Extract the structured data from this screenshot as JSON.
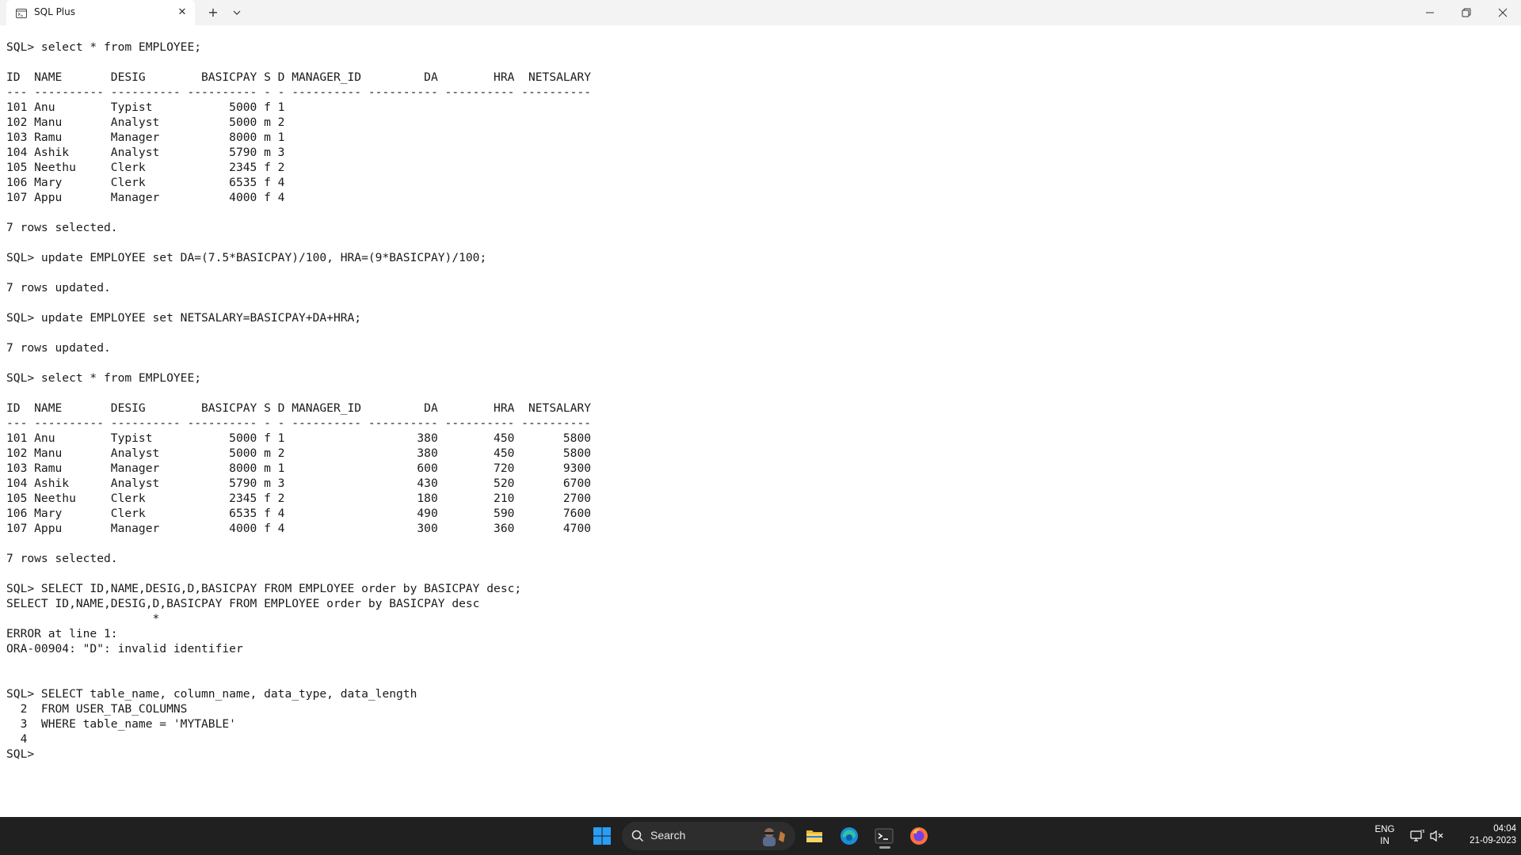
{
  "window": {
    "tab_title": "SQL Plus",
    "tab_close_glyph": "✕",
    "new_tab_glyph": "+",
    "dropdown_glyph": "⌄"
  },
  "console_lines": [
    "SQL> select * from EMPLOYEE;",
    "",
    "ID  NAME       DESIG        BASICPAY S D MANAGER_ID         DA        HRA  NETSALARY",
    "--- ---------- ---------- ---------- - - ---------- ---------- ---------- ----------",
    "101 Anu        Typist           5000 f 1",
    "102 Manu       Analyst          5000 m 2",
    "103 Ramu       Manager          8000 m 1",
    "104 Ashik      Analyst          5790 m 3",
    "105 Neethu     Clerk            2345 f 2",
    "106 Mary       Clerk            6535 f 4",
    "107 Appu       Manager          4000 f 4",
    "",
    "7 rows selected.",
    "",
    "SQL> update EMPLOYEE set DA=(7.5*BASICPAY)/100, HRA=(9*BASICPAY)/100;",
    "",
    "7 rows updated.",
    "",
    "SQL> update EMPLOYEE set NETSALARY=BASICPAY+DA+HRA;",
    "",
    "7 rows updated.",
    "",
    "SQL> select * from EMPLOYEE;",
    "",
    "ID  NAME       DESIG        BASICPAY S D MANAGER_ID         DA        HRA  NETSALARY",
    "--- ---------- ---------- ---------- - - ---------- ---------- ---------- ----------",
    "101 Anu        Typist           5000 f 1                   380        450       5800",
    "102 Manu       Analyst          5000 m 2                   380        450       5800",
    "103 Ramu       Manager          8000 m 1                   600        720       9300",
    "104 Ashik      Analyst          5790 m 3                   430        520       6700",
    "105 Neethu     Clerk            2345 f 2                   180        210       2700",
    "106 Mary       Clerk            6535 f 4                   490        590       7600",
    "107 Appu       Manager          4000 f 4                   300        360       4700",
    "",
    "7 rows selected.",
    "",
    "SQL> SELECT ID,NAME,DESIG,D,BASICPAY FROM EMPLOYEE order by BASICPAY desc;",
    "SELECT ID,NAME,DESIG,D,BASICPAY FROM EMPLOYEE order by BASICPAY desc",
    "                     *",
    "ERROR at line 1:",
    "ORA-00904: \"D\": invalid identifier",
    "",
    "",
    "SQL> SELECT table_name, column_name, data_type, data_length",
    "  2  FROM USER_TAB_COLUMNS",
    "  3  WHERE table_name = 'MYTABLE'",
    "  4",
    "SQL>"
  ],
  "taskbar": {
    "search_label": "Search",
    "language_line1": "ENG",
    "language_line2": "IN",
    "time": "04:04",
    "date": "21-09-2023"
  },
  "icons": {
    "tab": "terminal-icon",
    "start": "windows-start-icon",
    "explorer": "file-explorer-icon",
    "edge": "edge-browser-icon",
    "terminal": "terminal-app-icon",
    "firefox": "firefox-icon"
  },
  "colors": {
    "titlebar_bg": "#f3f3f3",
    "console_bg": "#ffffff",
    "console_text": "#1a1a1a",
    "taskbar_bg": "#202020",
    "windows_blue": "#2a9df4"
  }
}
